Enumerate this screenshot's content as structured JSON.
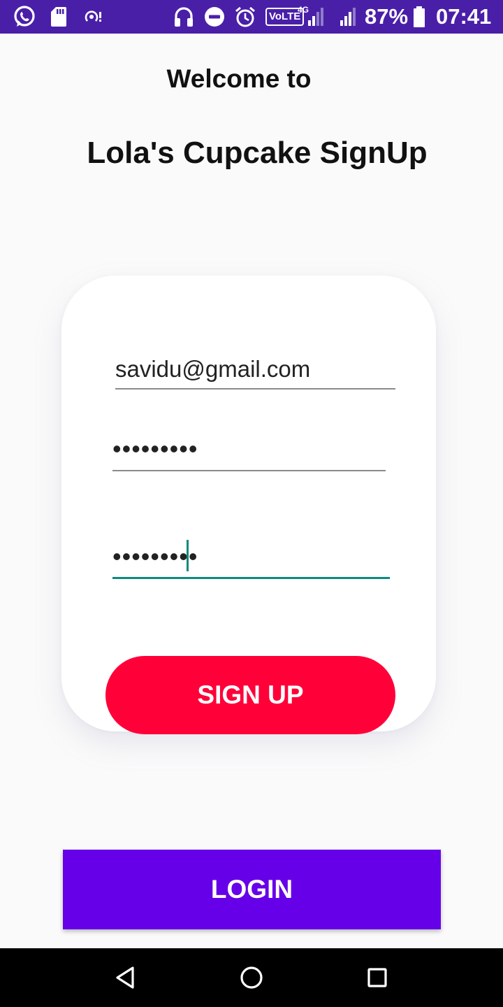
{
  "status_bar": {
    "battery": "87%",
    "time": "07:41",
    "network_label": "VoLTE",
    "network_gen": "4G",
    "icons": [
      "whatsapp-icon",
      "sd-card-icon",
      "hotspot-icon",
      "headphones-icon",
      "do-not-disturb-icon",
      "alarm-icon",
      "volte-icon",
      "signal-icon",
      "signal-icon",
      "battery-icon"
    ]
  },
  "header": {
    "welcome": "Welcome to",
    "title": "Lola's Cupcake SignUp"
  },
  "form": {
    "email_value": "savidu@gmail.com",
    "password_value": "123456789",
    "confirm_password_value": "123456789",
    "signup_label": "SIGN UP"
  },
  "login_label": "LOGIN",
  "nav": {
    "icons": [
      "back-icon",
      "home-icon",
      "recents-icon"
    ]
  },
  "colors": {
    "status_bar": "#4a1fa8",
    "signup_button": "#ff0038",
    "login_button": "#6600e8",
    "focus_underline": "#0f8a7e"
  }
}
